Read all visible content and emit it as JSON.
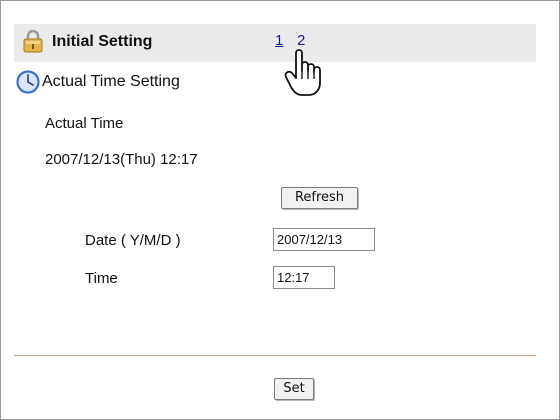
{
  "header": {
    "title": "Initial Setting",
    "pages": [
      "1",
      "2"
    ]
  },
  "section": {
    "title": "Actual Time Setting"
  },
  "actual_time": {
    "label": "Actual Time",
    "value": "2007/12/13(Thu) 12:17",
    "refresh_label": "Refresh"
  },
  "form": {
    "date_label": "Date ( Y/M/D )",
    "date_value": "2007/12/13",
    "time_label": "Time",
    "time_value": "12:17",
    "set_label": "Set"
  },
  "icons": {
    "header": "lock-icon",
    "section": "clock-icon",
    "cursor": "hand-pointer-icon"
  },
  "colors": {
    "header_band": "#ebebeb",
    "link": "#1a1aa0",
    "divider": "#c9a283",
    "clock": "#3a6fd0"
  }
}
